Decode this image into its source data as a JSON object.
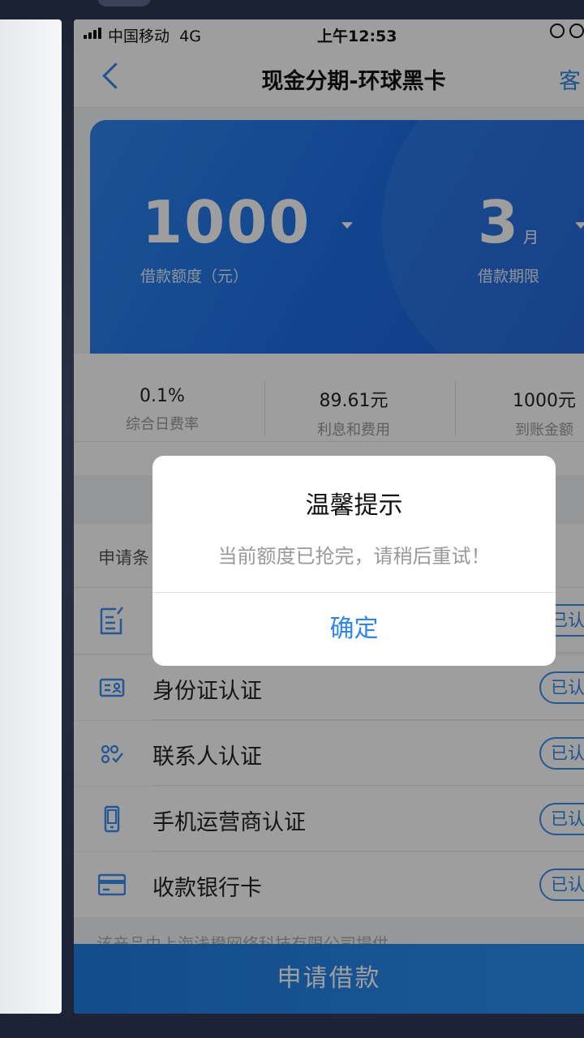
{
  "status_bar": {
    "carrier": "中国移动",
    "network": "4G",
    "time": "上午12:53"
  },
  "nav": {
    "title": "现金分期-环球黑卡",
    "right_label": "客"
  },
  "hero": {
    "amount": "1000",
    "amount_label": "借款额度（元）",
    "term": "3",
    "term_unit": "月",
    "term_label": "借款期限"
  },
  "stats": [
    {
      "value": "0.1%",
      "label": "综合日费率"
    },
    {
      "value": "89.61元",
      "label": "利息和费用"
    },
    {
      "value": "1000元",
      "label": "到账金额"
    }
  ],
  "conditions": {
    "header": "申请条",
    "items": [
      {
        "label": "",
        "status": "已认",
        "icon": "document-edit-icon"
      },
      {
        "label": "身份证认证",
        "status": "已认",
        "icon": "id-card-icon"
      },
      {
        "label": "联系人认证",
        "status": "已认",
        "icon": "contacts-icon"
      },
      {
        "label": "手机运营商认证",
        "status": "已认",
        "icon": "phone-icon"
      },
      {
        "label": "收款银行卡",
        "status": "已认",
        "icon": "bank-card-icon"
      }
    ]
  },
  "footer_note": "该产品由上海浅橙网络科技有限公司提供",
  "apply_button": "申请借款",
  "dialog": {
    "title": "温馨提示",
    "message": "当前额度已抢完，请稍后重试！",
    "confirm": "确定"
  },
  "colors": {
    "accent": "#2f86e6",
    "hero_blue": "#1e6fe6"
  }
}
